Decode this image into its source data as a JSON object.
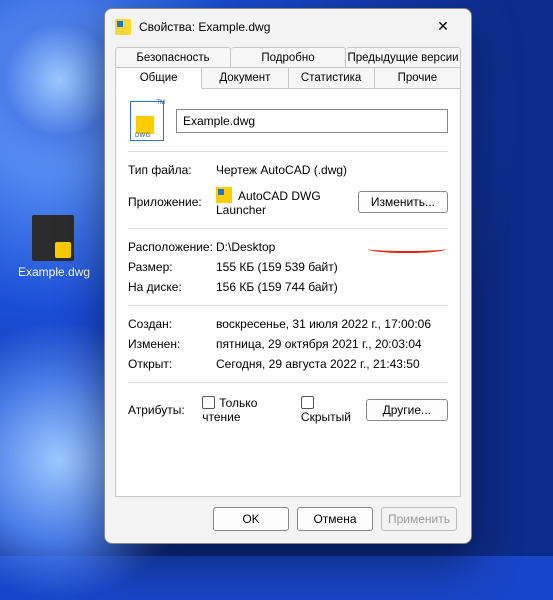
{
  "desktop": {
    "file_label": "Example.dwg"
  },
  "dialog": {
    "title": "Свойства: Example.dwg",
    "tabs_row1": [
      "Безопасность",
      "Подробно",
      "Предыдущие версии"
    ],
    "tabs_row2": [
      "Общие",
      "Документ",
      "Статистика",
      "Прочие"
    ],
    "filename": "Example.dwg",
    "labels": {
      "file_type": "Тип файла:",
      "app": "Приложение:",
      "location": "Расположение:",
      "size": "Размер:",
      "on_disk": "На диске:",
      "created": "Создан:",
      "modified": "Изменен:",
      "opened": "Открыт:",
      "attrs": "Атрибуты:"
    },
    "values": {
      "file_type": "Чертеж AutoCAD (.dwg)",
      "app": "AutoCAD DWG Launcher",
      "location": "D:\\Desktop",
      "size": "155 КБ (159 539 байт)",
      "on_disk": "156 КБ (159 744 байт)",
      "created": "воскресенье, 31 июля 2022 г., 17:00:06",
      "modified": "пятница, 29 октября 2021 г., 20:03:04",
      "opened": "Сегодня, 29 августа 2022 г., 21:43:50"
    },
    "buttons": {
      "change": "Изменить...",
      "other": "Другие...",
      "ok": "OK",
      "cancel": "Отмена",
      "apply": "Применить"
    },
    "checkboxes": {
      "readonly": "Только чтение",
      "hidden": "Скрытый"
    }
  }
}
